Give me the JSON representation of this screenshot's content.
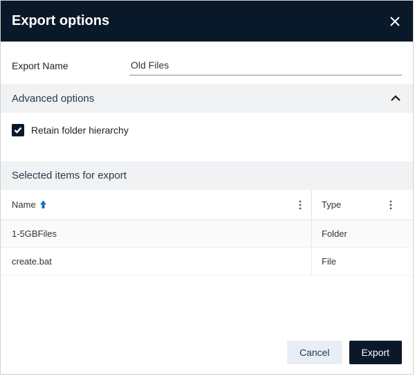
{
  "header": {
    "title": "Export options"
  },
  "export_name": {
    "label": "Export Name",
    "value": "Old Files"
  },
  "advanced": {
    "title": "Advanced options",
    "retain_folder_label": "Retain folder hierarchy",
    "retain_folder_checked": true
  },
  "selected_section": {
    "title": "Selected items for export"
  },
  "table": {
    "columns": {
      "name": "Name",
      "type": "Type"
    },
    "rows": [
      {
        "name": "1-5GBFiles",
        "type": "Folder"
      },
      {
        "name": "create.bat",
        "type": "File"
      }
    ]
  },
  "footer": {
    "cancel": "Cancel",
    "export": "Export"
  }
}
